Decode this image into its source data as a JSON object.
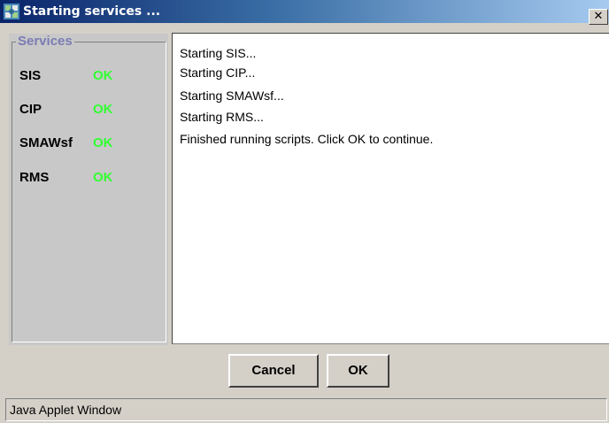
{
  "window": {
    "title": "Starting services ...",
    "close_glyph": "✕",
    "app_icon": "java-applet-icon"
  },
  "services": {
    "legend": "Services",
    "items": [
      {
        "name": "SIS",
        "status": "OK"
      },
      {
        "name": "CIP",
        "status": "OK"
      },
      {
        "name": "SMAWsf",
        "status": "OK"
      },
      {
        "name": "RMS",
        "status": "OK"
      }
    ],
    "status_color": "#33ff33"
  },
  "log": {
    "lines": [
      "Starting SIS...",
      "Starting CIP...",
      "Starting SMAWsf...",
      "Starting RMS...",
      "Finished running scripts.  Click OK to continue."
    ]
  },
  "buttons": {
    "cancel_label": "Cancel",
    "ok_label": "OK"
  },
  "statusbar": {
    "text": "Java Applet Window"
  }
}
